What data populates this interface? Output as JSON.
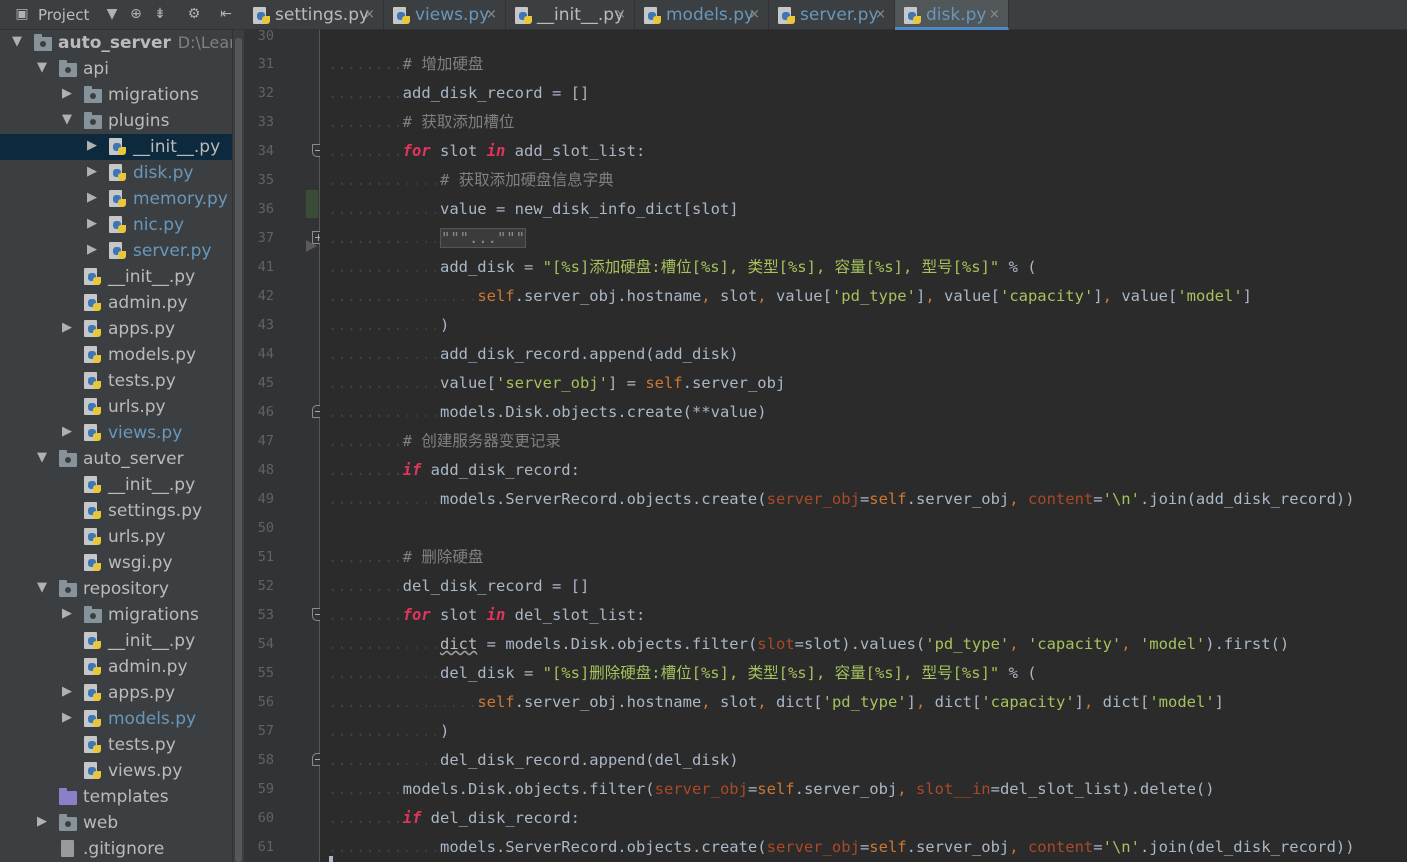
{
  "project_panel": {
    "title": "Project",
    "header_icons": [
      "dropdown-arrow-icon",
      "target-icon",
      "collapse-all-icon",
      "gear-icon",
      "hide-panel-icon"
    ]
  },
  "tree": [
    {
      "label": "auto_server",
      "path": "D:\\Learn\\P",
      "type": "folder",
      "arrow": "down",
      "depth": 0,
      "bold": true
    },
    {
      "label": "api",
      "type": "folder",
      "arrow": "down",
      "depth": 1
    },
    {
      "label": "migrations",
      "type": "folder",
      "arrow": "right",
      "depth": 2
    },
    {
      "label": "plugins",
      "type": "folder",
      "arrow": "down",
      "depth": 2
    },
    {
      "label": "__init__.py",
      "type": "py",
      "arrow": "right",
      "depth": 3,
      "selected": true
    },
    {
      "label": "disk.py",
      "type": "py",
      "arrow": "right",
      "depth": 3,
      "vcs": true
    },
    {
      "label": "memory.py",
      "type": "py",
      "arrow": "right",
      "depth": 3,
      "vcs": true
    },
    {
      "label": "nic.py",
      "type": "py",
      "arrow": "right",
      "depth": 3,
      "vcs": true
    },
    {
      "label": "server.py",
      "type": "py",
      "arrow": "right",
      "depth": 3,
      "vcs": true
    },
    {
      "label": "__init__.py",
      "type": "py",
      "arrow": "",
      "depth": 2
    },
    {
      "label": "admin.py",
      "type": "py",
      "arrow": "",
      "depth": 2
    },
    {
      "label": "apps.py",
      "type": "py",
      "arrow": "right",
      "depth": 2
    },
    {
      "label": "models.py",
      "type": "py",
      "arrow": "",
      "depth": 2
    },
    {
      "label": "tests.py",
      "type": "py",
      "arrow": "",
      "depth": 2
    },
    {
      "label": "urls.py",
      "type": "py",
      "arrow": "",
      "depth": 2
    },
    {
      "label": "views.py",
      "type": "py",
      "arrow": "right",
      "depth": 2,
      "vcs": true
    },
    {
      "label": "auto_server",
      "type": "folder",
      "arrow": "down",
      "depth": 1
    },
    {
      "label": "__init__.py",
      "type": "py",
      "arrow": "",
      "depth": 2
    },
    {
      "label": "settings.py",
      "type": "py",
      "arrow": "",
      "depth": 2
    },
    {
      "label": "urls.py",
      "type": "py",
      "arrow": "",
      "depth": 2
    },
    {
      "label": "wsgi.py",
      "type": "py",
      "arrow": "",
      "depth": 2
    },
    {
      "label": "repository",
      "type": "folder",
      "arrow": "down",
      "depth": 1
    },
    {
      "label": "migrations",
      "type": "folder",
      "arrow": "right",
      "depth": 2
    },
    {
      "label": "__init__.py",
      "type": "py",
      "arrow": "",
      "depth": 2
    },
    {
      "label": "admin.py",
      "type": "py",
      "arrow": "",
      "depth": 2
    },
    {
      "label": "apps.py",
      "type": "py",
      "arrow": "right",
      "depth": 2
    },
    {
      "label": "models.py",
      "type": "py",
      "arrow": "right",
      "depth": 2,
      "vcs": true
    },
    {
      "label": "tests.py",
      "type": "py",
      "arrow": "",
      "depth": 2
    },
    {
      "label": "views.py",
      "type": "py",
      "arrow": "",
      "depth": 2
    },
    {
      "label": "templates",
      "type": "plainfolder",
      "arrow": "",
      "depth": 1
    },
    {
      "label": "web",
      "type": "folder",
      "arrow": "right",
      "depth": 1
    },
    {
      "label": ".gitignore",
      "type": "file",
      "arrow": "",
      "depth": 1
    }
  ],
  "tabs": [
    {
      "label": "settings.py",
      "active": false,
      "vcs": false
    },
    {
      "label": "views.py",
      "active": false,
      "vcs": true
    },
    {
      "label": "__init__.py",
      "active": false,
      "vcs": false
    },
    {
      "label": "models.py",
      "active": false,
      "vcs": true
    },
    {
      "label": "server.py",
      "active": false,
      "vcs": true
    },
    {
      "label": "disk.py",
      "active": true,
      "vcs": true
    }
  ],
  "tab_close_glyph": "×",
  "editor": {
    "line_numbers": [
      "30",
      "31",
      "32",
      "33",
      "34",
      "35",
      "36",
      "37",
      "41",
      "42",
      "43",
      "44",
      "45",
      "46",
      "47",
      "48",
      "49",
      "50",
      "51",
      "52",
      "53",
      "54",
      "55",
      "56",
      "57",
      "58",
      "59",
      "60",
      "61"
    ],
    "lines": [
      {
        "n": "30",
        "segs": []
      },
      {
        "n": "31",
        "segs": [
          [
            "ws",
            "........"
          ],
          [
            "cm",
            "# 增加硬盘"
          ]
        ]
      },
      {
        "n": "32",
        "segs": [
          [
            "ws",
            "........"
          ],
          [
            "id",
            "add_disk_record"
          ],
          [
            "op",
            " = "
          ],
          [
            "id",
            "[]"
          ]
        ]
      },
      {
        "n": "33",
        "segs": [
          [
            "ws",
            "........"
          ],
          [
            "cm",
            "# 获取添加槽位"
          ]
        ]
      },
      {
        "n": "34",
        "segs": [
          [
            "ws",
            "........"
          ],
          [
            "kwr",
            "for"
          ],
          [
            "id",
            " slot "
          ],
          [
            "kwr",
            "in"
          ],
          [
            "id",
            " add_slot_list:"
          ]
        ]
      },
      {
        "n": "35",
        "segs": [
          [
            "ws",
            "........"
          ],
          [
            "bar",
            "...."
          ],
          [
            "cm",
            "# 获取添加硬盘信息字典"
          ]
        ]
      },
      {
        "n": "36",
        "segs": [
          [
            "ws",
            "........"
          ],
          [
            "bar",
            "...."
          ],
          [
            "id",
            "value"
          ],
          [
            "op",
            " = "
          ],
          [
            "id",
            "new_disk_info_dict[slot]"
          ]
        ]
      },
      {
        "n": "37",
        "segs": [
          [
            "ws",
            "........"
          ],
          [
            "bar",
            "...."
          ],
          [
            "fd",
            "\"\"\"...\"\"\""
          ]
        ]
      },
      {
        "n": "41",
        "segs": [
          [
            "ws",
            "........"
          ],
          [
            "bar",
            "...."
          ],
          [
            "id",
            "add_disk"
          ],
          [
            "op",
            " = "
          ],
          [
            "st",
            "\"[%s]添加硬盘:槽位[%s], 类型[%s], 容量[%s], 型号[%s]\""
          ],
          [
            "op",
            " % ("
          ]
        ]
      },
      {
        "n": "42",
        "segs": [
          [
            "ws",
            "........"
          ],
          [
            "bar",
            "...."
          ],
          [
            "bar",
            "...."
          ],
          [
            "self",
            "self"
          ],
          [
            "id",
            ".server_obj.hostname"
          ],
          [
            "pu",
            ","
          ],
          [
            "id",
            " slot"
          ],
          [
            "pu",
            ","
          ],
          [
            "id",
            " value["
          ],
          [
            "st",
            "'pd_type'"
          ],
          [
            "id",
            "]"
          ],
          [
            "pu",
            ","
          ],
          [
            "id",
            " value["
          ],
          [
            "st",
            "'capacity'"
          ],
          [
            "id",
            "]"
          ],
          [
            "pu",
            ","
          ],
          [
            "id",
            " value["
          ],
          [
            "st",
            "'model'"
          ],
          [
            "id",
            "]"
          ]
        ]
      },
      {
        "n": "43",
        "segs": [
          [
            "ws",
            "........"
          ],
          [
            "bar",
            "...."
          ],
          [
            "id",
            ")"
          ]
        ]
      },
      {
        "n": "44",
        "segs": [
          [
            "ws",
            "........"
          ],
          [
            "bar",
            "...."
          ],
          [
            "id",
            "add_disk_record.append(add_disk)"
          ]
        ]
      },
      {
        "n": "45",
        "segs": [
          [
            "ws",
            "........"
          ],
          [
            "bar",
            "...."
          ],
          [
            "id",
            "value["
          ],
          [
            "st",
            "'server_obj'"
          ],
          [
            "id",
            "]"
          ],
          [
            "op",
            " = "
          ],
          [
            "self",
            "self"
          ],
          [
            "id",
            ".server_obj"
          ]
        ]
      },
      {
        "n": "46",
        "segs": [
          [
            "ws",
            "........"
          ],
          [
            "bar",
            "...."
          ],
          [
            "id",
            "models.Disk.objects.create(**value)"
          ]
        ]
      },
      {
        "n": "47",
        "segs": [
          [
            "ws",
            "........"
          ],
          [
            "cm",
            "# 创建服务器变更记录"
          ]
        ]
      },
      {
        "n": "48",
        "segs": [
          [
            "ws",
            "........"
          ],
          [
            "kwr",
            "if"
          ],
          [
            "id",
            " add_disk_record:"
          ]
        ]
      },
      {
        "n": "49",
        "segs": [
          [
            "ws",
            "........"
          ],
          [
            "bar",
            "...."
          ],
          [
            "id",
            "models.ServerRecord.objects.create("
          ],
          [
            "pm",
            "server_obj"
          ],
          [
            "id",
            "="
          ],
          [
            "self",
            "self"
          ],
          [
            "id",
            ".server_obj"
          ],
          [
            "pu",
            ","
          ],
          [
            "pm",
            " content"
          ],
          [
            "id",
            "="
          ],
          [
            "st",
            "'\\n'"
          ],
          [
            "id",
            ".join(add_disk_record))"
          ]
        ]
      },
      {
        "n": "50",
        "segs": []
      },
      {
        "n": "51",
        "segs": [
          [
            "ws",
            "........"
          ],
          [
            "cm",
            "# 删除硬盘"
          ]
        ]
      },
      {
        "n": "52",
        "segs": [
          [
            "ws",
            "........"
          ],
          [
            "id",
            "del_disk_record"
          ],
          [
            "op",
            " = "
          ],
          [
            "id",
            "[]"
          ]
        ]
      },
      {
        "n": "53",
        "segs": [
          [
            "ws",
            "........"
          ],
          [
            "kwr",
            "for"
          ],
          [
            "id",
            " slot "
          ],
          [
            "kwr",
            "in"
          ],
          [
            "id",
            " del_slot_list:"
          ]
        ]
      },
      {
        "n": "54",
        "segs": [
          [
            "ws",
            "........"
          ],
          [
            "bar",
            "...."
          ],
          [
            "ul",
            "dict"
          ],
          [
            "op",
            " = "
          ],
          [
            "id",
            "models.Disk.objects.filter("
          ],
          [
            "pm",
            "slot"
          ],
          [
            "id",
            "=slot).values("
          ],
          [
            "st",
            "'pd_type'"
          ],
          [
            "pu",
            ","
          ],
          [
            "st",
            " 'capacity'"
          ],
          [
            "pu",
            ","
          ],
          [
            "st",
            " 'model'"
          ],
          [
            "id",
            ").first()"
          ]
        ]
      },
      {
        "n": "55",
        "segs": [
          [
            "ws",
            "........"
          ],
          [
            "bar",
            "...."
          ],
          [
            "id",
            "del_disk"
          ],
          [
            "op",
            " = "
          ],
          [
            "st",
            "\"[%s]删除硬盘:槽位[%s], 类型[%s], 容量[%s], 型号[%s]\""
          ],
          [
            "op",
            " % ("
          ]
        ]
      },
      {
        "n": "56",
        "segs": [
          [
            "ws",
            "........"
          ],
          [
            "bar",
            "...."
          ],
          [
            "bar",
            "...."
          ],
          [
            "self",
            "self"
          ],
          [
            "id",
            ".server_obj.hostname"
          ],
          [
            "pu",
            ","
          ],
          [
            "id",
            " slot"
          ],
          [
            "pu",
            ","
          ],
          [
            "id",
            " dict["
          ],
          [
            "st",
            "'pd_type'"
          ],
          [
            "id",
            "]"
          ],
          [
            "pu",
            ","
          ],
          [
            "id",
            " dict["
          ],
          [
            "st",
            "'capacity'"
          ],
          [
            "id",
            "]"
          ],
          [
            "pu",
            ","
          ],
          [
            "id",
            " dict["
          ],
          [
            "st",
            "'model'"
          ],
          [
            "id",
            "]"
          ]
        ]
      },
      {
        "n": "57",
        "segs": [
          [
            "ws",
            "........"
          ],
          [
            "bar",
            "...."
          ],
          [
            "id",
            ")"
          ]
        ]
      },
      {
        "n": "58",
        "segs": [
          [
            "ws",
            "........"
          ],
          [
            "bar",
            "...."
          ],
          [
            "id",
            "del_disk_record.append(del_disk)"
          ]
        ]
      },
      {
        "n": "59",
        "segs": [
          [
            "ws",
            "........"
          ],
          [
            "id",
            "models.Disk.objects.filter("
          ],
          [
            "pm",
            "server_obj"
          ],
          [
            "id",
            "="
          ],
          [
            "self",
            "self"
          ],
          [
            "id",
            ".server_obj"
          ],
          [
            "pu",
            ","
          ],
          [
            "pm",
            " slot__in"
          ],
          [
            "id",
            "=del_slot_list).delete()"
          ]
        ]
      },
      {
        "n": "60",
        "segs": [
          [
            "ws",
            "........"
          ],
          [
            "kwr",
            "if"
          ],
          [
            "id",
            " del_disk_record:"
          ]
        ]
      },
      {
        "n": "61",
        "segs": [
          [
            "ws",
            "........"
          ],
          [
            "bar",
            "...."
          ],
          [
            "id",
            "models.ServerRecord.objects.create("
          ],
          [
            "pm",
            "server_obj"
          ],
          [
            "id",
            "="
          ],
          [
            "self",
            "self"
          ],
          [
            "id",
            ".server_obj"
          ],
          [
            "pu",
            ","
          ],
          [
            "pm",
            " content"
          ],
          [
            "id",
            "="
          ],
          [
            "st",
            "'\\n'"
          ],
          [
            "id",
            ".join(del_disk_record))"
          ]
        ]
      }
    ]
  },
  "colors": {
    "keyword": "#e0355b",
    "string": "#a5c25c",
    "comment": "#808080",
    "self": "#cc7832",
    "param": "#aa4926",
    "identifier": "#a9b7c6",
    "vcs_modified": "#6897bb",
    "active_tab_underline": "#4a88c7"
  }
}
